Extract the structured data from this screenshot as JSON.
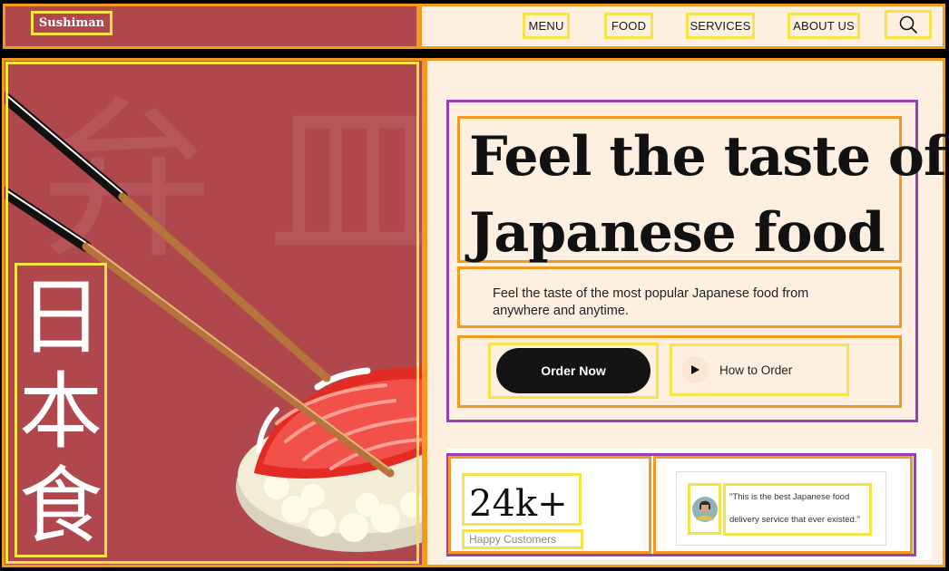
{
  "brand": {
    "name": "Sushiman"
  },
  "nav": {
    "items": [
      "MENU",
      "FOOD",
      "SERVICES",
      "ABOUT US"
    ],
    "search_icon": "search-icon"
  },
  "hero": {
    "kanji_vertical": [
      "日",
      "本",
      "食"
    ],
    "kanji_background": "弁 皿",
    "headline_line1": "Feel the taste of",
    "headline_line2": "Japanese food",
    "subtext_line1": "Feel the taste of the most popular Japanese food from",
    "subtext_line2": "anywhere and anytime.",
    "primary_cta": "Order Now",
    "secondary_cta": "How to Order",
    "play_icon": "play-icon"
  },
  "stats": {
    "value": "24k+",
    "label": "Happy Customers"
  },
  "testimonial": {
    "quote_line1": "\"This is the best Japanese food",
    "quote_line2": "delivery service that ever existed.\""
  },
  "colors": {
    "brand_red": "#b0474c",
    "cream": "#fdf0e0",
    "dark": "#141414",
    "orange_outline": "#f39a1e",
    "purple_outline": "#9b3fb8",
    "yellow_outline": "#f6e34a"
  }
}
